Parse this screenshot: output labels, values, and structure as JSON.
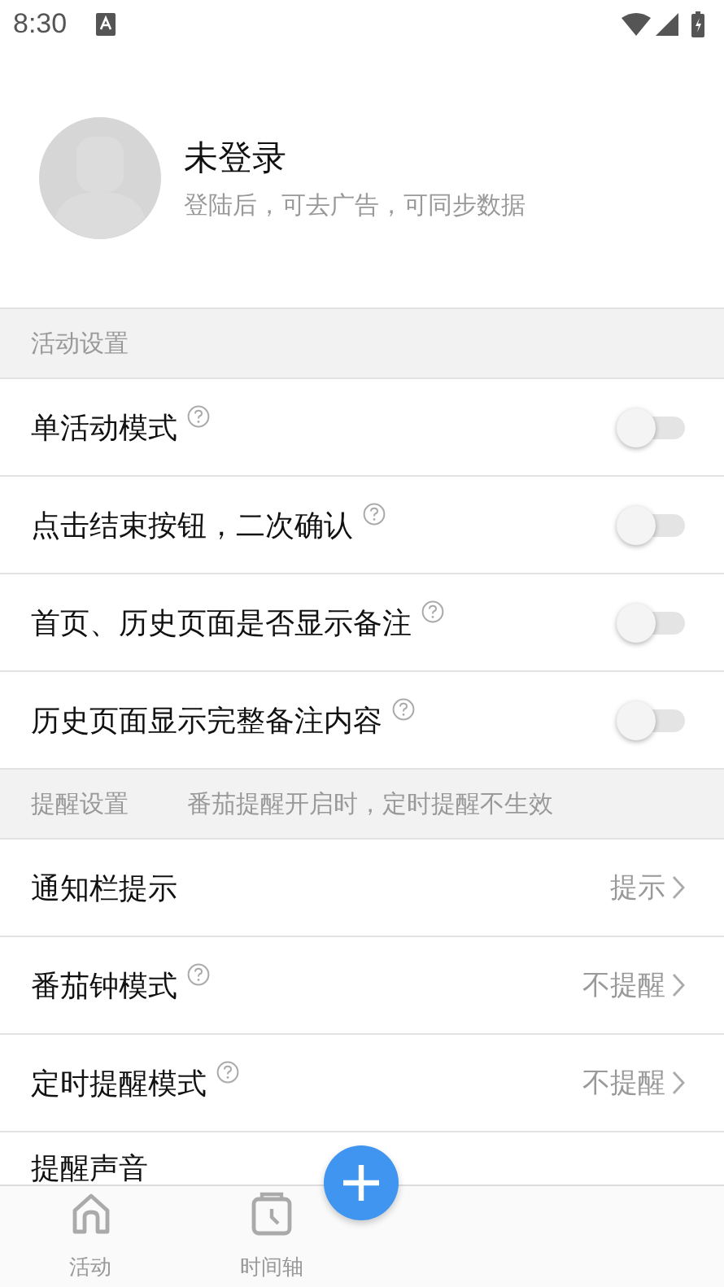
{
  "status_bar": {
    "time": "8:30"
  },
  "profile": {
    "name": "未登录",
    "subtitle": "登陆后，可去广告，可同步数据"
  },
  "sections": [
    {
      "title": "活动设置",
      "rows": [
        {
          "kind": "toggle",
          "label": "单活动模式",
          "help": true,
          "on": false
        },
        {
          "kind": "toggle",
          "label": "点击结束按钮，二次确认",
          "help": true,
          "on": false
        },
        {
          "kind": "toggle",
          "label": "首页、历史页面是否显示备注",
          "help": true,
          "on": false
        },
        {
          "kind": "toggle",
          "label": "历史页面显示完整备注内容",
          "help": true,
          "on": false
        }
      ]
    },
    {
      "title": "提醒设置",
      "note": "番茄提醒开启时，定时提醒不生效",
      "rows": [
        {
          "kind": "value",
          "label": "通知栏提示",
          "help": false,
          "value": "提示"
        },
        {
          "kind": "value",
          "label": "番茄钟模式",
          "help": true,
          "value": "不提醒"
        },
        {
          "kind": "value",
          "label": "定时提醒模式",
          "help": true,
          "value": "不提醒"
        },
        {
          "kind": "plain",
          "label": "提醒声音",
          "help": false
        }
      ]
    }
  ],
  "bottom_nav": [
    {
      "label": "活动"
    },
    {
      "label": "时间轴"
    }
  ]
}
